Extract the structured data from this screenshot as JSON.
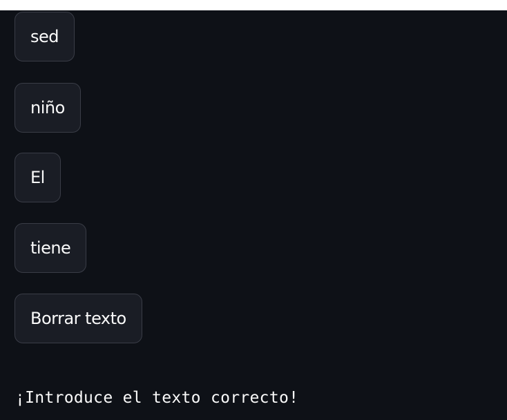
{
  "buttons": [
    {
      "label": "sed"
    },
    {
      "label": "niño"
    },
    {
      "label": "El"
    },
    {
      "label": "tiene"
    },
    {
      "label": "Borrar texto"
    }
  ],
  "message": "¡Introduce el texto correcto!"
}
